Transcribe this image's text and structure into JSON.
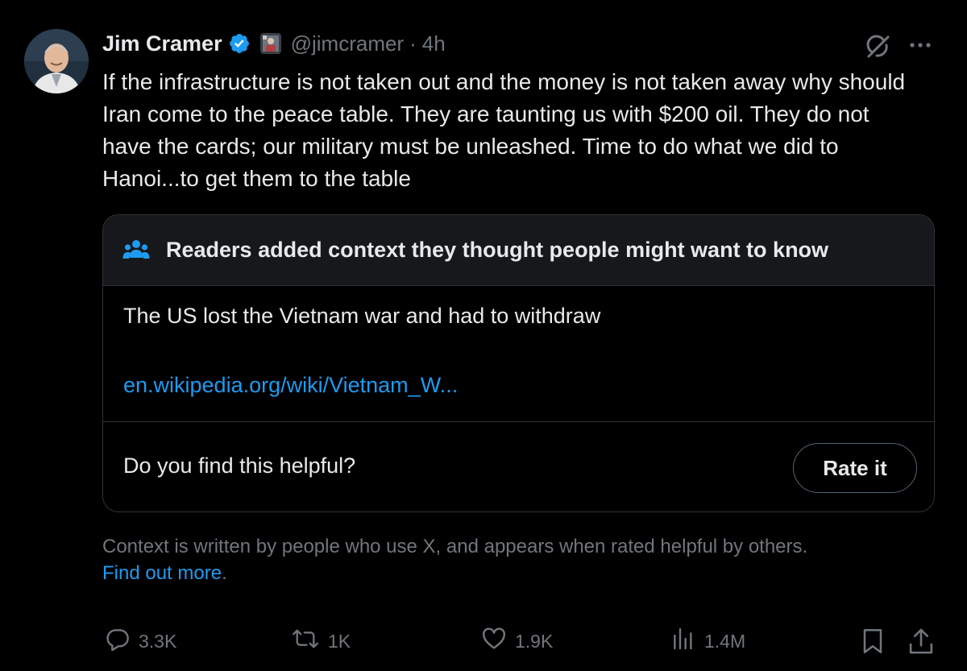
{
  "author": {
    "name": "Jim Cramer",
    "handle": "@jimcramer",
    "separator": "·",
    "time": "4h"
  },
  "tweet": {
    "text": "If the infrastructure is not taken out and the money is not taken away why should Iran come to the peace table. They are taunting us with $200 oil. They do not have the cards; our military must be unleashed. Time to do what we did to Hanoi...to get them to the table"
  },
  "community_note": {
    "header": "Readers added context they thought people might want to know",
    "body": "The US lost the Vietnam war and had to withdraw",
    "link_text": "en.wikipedia.org/wiki/Vietnam_W...",
    "question": "Do you find this helpful?",
    "rate_button": "Rate it"
  },
  "disclaimer": {
    "text": "Context is written by people who use X, and appears when rated helpful by others.",
    "link": "Find out more",
    "link_suffix": "."
  },
  "actions": {
    "replies": "3.3K",
    "reposts": "1K",
    "likes": "1.9K",
    "views": "1.4M"
  },
  "icons": {
    "verified": "verified-badge-icon",
    "grok": "grok-icon",
    "more": "more-icon",
    "people": "people-icon",
    "reply": "reply-icon",
    "repost": "repost-icon",
    "like": "heart-icon",
    "views": "views-icon",
    "bookmark": "bookmark-icon",
    "share": "share-icon"
  },
  "colors": {
    "background": "#000000",
    "text": "#e7e9ea",
    "secondary": "#71767b",
    "accent": "#1d9bf0",
    "border": "#2f3336",
    "note_header_bg": "#16181c"
  }
}
